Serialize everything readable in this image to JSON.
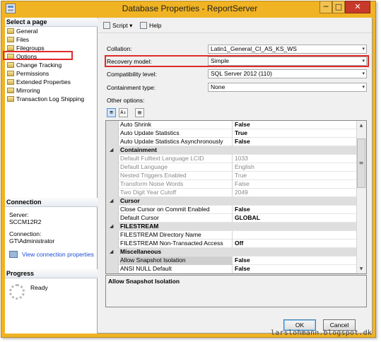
{
  "window": {
    "title": "Database Properties - ReportServer",
    "minimize_glyph": "─",
    "maximize_glyph": "□",
    "close_glyph": "✕"
  },
  "left": {
    "select_page_header": "Select a page",
    "pages": [
      "General",
      "Files",
      "Filegroups",
      "Options",
      "Change Tracking",
      "Permissions",
      "Extended Properties",
      "Mirroring",
      "Transaction Log Shipping"
    ],
    "selected_page": "Options",
    "connection_header": "Connection",
    "server_label": "Server:",
    "server_value": "SCCM12R2",
    "connection_label": "Connection:",
    "connection_value": "GT\\Administrator",
    "view_connection_link": "View connection properties",
    "progress_header": "Progress",
    "progress_status": "Ready"
  },
  "toolbar": {
    "script_label": "Script",
    "script_arrow": "▾",
    "help_label": "Help"
  },
  "fields": {
    "collation_label": "Collation:",
    "collation_value": "Latin1_General_CI_AS_KS_WS",
    "recovery_label": "Recovery model:",
    "recovery_value": "Simple",
    "compat_label": "Compatibility level:",
    "compat_value": "SQL Server 2012 (110)",
    "containment_label": "Containment type:",
    "containment_value": "None",
    "other_options_label": "Other options:",
    "combo_arrow": "▾"
  },
  "prop_toolbar": {
    "categorized_glyph": "⊞",
    "alphabetical_glyph": "A↓",
    "pages_glyph": "▤"
  },
  "grid": {
    "rows": [
      {
        "name": "Auto Shrink",
        "value": "False"
      },
      {
        "name": "Auto Update Statistics",
        "value": "True"
      },
      {
        "name": "Auto Update Statistics Asynchronously",
        "value": "False"
      },
      {
        "category": "Containment",
        "toggle": "◢"
      },
      {
        "name": "Default Fulltext Language LCID",
        "value": "1033",
        "disabled": true
      },
      {
        "name": "Default Language",
        "value": "English",
        "disabled": true
      },
      {
        "name": "Nested Triggers Enabled",
        "value": "True",
        "disabled": true
      },
      {
        "name": "Transform Noise Words",
        "value": "False",
        "disabled": true
      },
      {
        "name": "Two Digit Year Cutoff",
        "value": "2049",
        "disabled": true
      },
      {
        "category": "Cursor",
        "toggle": "◢"
      },
      {
        "name": "Close Cursor on Commit Enabled",
        "value": "False"
      },
      {
        "name": "Default Cursor",
        "value": "GLOBAL"
      },
      {
        "category": "FILESTREAM",
        "toggle": "◢"
      },
      {
        "name": "FILESTREAM Directory Name",
        "value": ""
      },
      {
        "name": "FILESTREAM Non-Transacted Access",
        "value": "Off"
      },
      {
        "category": "Miscellaneous",
        "toggle": "◢"
      },
      {
        "name": "Allow Snapshot Isolation",
        "value": "False",
        "selected": true
      },
      {
        "name": "ANSI NULL Default",
        "value": "False"
      }
    ],
    "scroll_up": "▲",
    "scroll_down": "▼",
    "thumb_grip": "≡"
  },
  "description": "Allow Snapshot Isolation",
  "buttons": {
    "ok": "OK",
    "cancel": "Cancel"
  },
  "watermark": "larslohmann.blogspot.dk",
  "colors": {
    "frame": "#f0b323",
    "highlight_red": "#e02a2a",
    "link_blue": "#1d4ed8"
  },
  "icons": [
    "window-system-icon",
    "script-icon",
    "help-icon",
    "page-icon",
    "connection-icon",
    "progress-spinner-icon"
  ]
}
